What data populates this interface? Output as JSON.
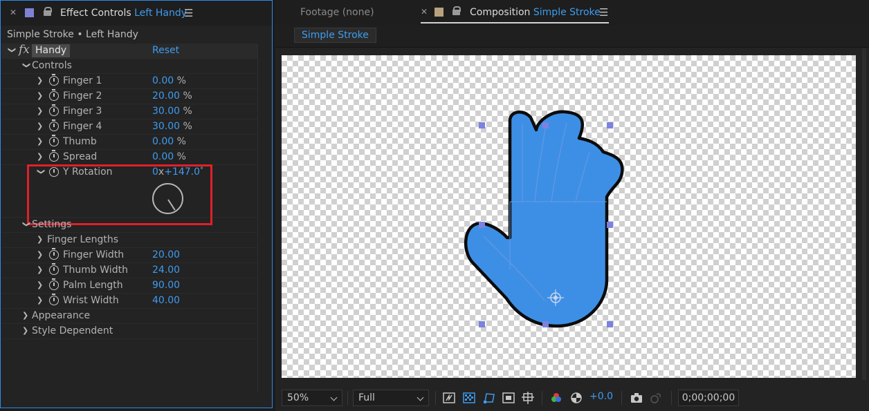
{
  "effect_controls": {
    "tab_label": "Effect Controls",
    "tab_layer": "Left Handy",
    "subtitle": "Simple Stroke • Left Handy",
    "effect_name": "Handy",
    "reset_label": "Reset",
    "groups": {
      "controls": "Controls",
      "settings": "Settings",
      "appearance": "Appearance",
      "style_dependent": "Style Dependent"
    },
    "params": [
      {
        "label": "Finger 1",
        "value": "0.00",
        "unit": "%"
      },
      {
        "label": "Finger 2",
        "value": "20.00",
        "unit": "%"
      },
      {
        "label": "Finger 3",
        "value": "30.00",
        "unit": "%"
      },
      {
        "label": "Finger 4",
        "value": "30.00",
        "unit": "%"
      },
      {
        "label": "Thumb",
        "value": "0.00",
        "unit": "%"
      },
      {
        "label": "Spread",
        "value": "0.00",
        "unit": "%"
      }
    ],
    "y_rotation": {
      "label": "Y Rotation",
      "revolutions": "0",
      "x_sep": "x",
      "degrees": "+147.0",
      "deg_unit": "°"
    },
    "settings_params": [
      {
        "label": "Finger Lengths",
        "value": ""
      },
      {
        "label": "Finger Width",
        "value": "20.00"
      },
      {
        "label": "Thumb Width",
        "value": "24.00"
      },
      {
        "label": "Palm Length",
        "value": "90.00"
      },
      {
        "label": "Wrist Width",
        "value": "40.00"
      }
    ]
  },
  "composition": {
    "footage_tab": "Footage",
    "footage_value": "(none)",
    "comp_tab_label": "Composition",
    "comp_name": "Simple Stroke",
    "comp_chip": "Simple Stroke"
  },
  "viewer_controls": {
    "zoom": "50%",
    "resolution": "Full",
    "exposure": "+0.0",
    "timecode": "0;00;00;00"
  },
  "colors": {
    "accent_blue": "#3e9cf0",
    "hand_fill": "#3d8fe6",
    "highlight_red": "#e0202a",
    "ec_swatch": "#7e82d6",
    "comp_swatch": "#b8a27e"
  }
}
